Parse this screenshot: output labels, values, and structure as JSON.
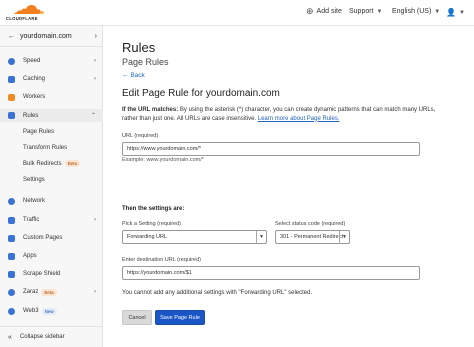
{
  "topbar": {
    "logo_text": "CLOUDFLARE",
    "add_site": "Add site",
    "support": "Support",
    "language": "English (US)"
  },
  "sidebar": {
    "domain": "yourdomain.com",
    "items": [
      {
        "label": "Speed",
        "icon": "speed-icon",
        "color": "#3b73d4",
        "chev": "›"
      },
      {
        "label": "Caching",
        "icon": "caching-icon",
        "color": "#3b73d4",
        "chev": "›"
      },
      {
        "label": "Workers",
        "icon": "workers-icon",
        "color": "#f08a24",
        "chev": ""
      },
      {
        "label": "Rules",
        "icon": "rules-icon",
        "color": "#3b73d4",
        "chev": "⌄"
      },
      {
        "label": "Page Rules"
      },
      {
        "label": "Transform Rules"
      },
      {
        "label": "Bulk Redirects",
        "badge": "Beta"
      },
      {
        "label": "Settings"
      },
      {
        "label": "Network",
        "icon": "network-icon",
        "color": "#3b73d4",
        "chev": ""
      },
      {
        "label": "Traffic",
        "icon": "traffic-icon",
        "color": "#3b73d4",
        "chev": "›"
      },
      {
        "label": "Custom Pages",
        "icon": "custom-pages-icon",
        "color": "#3b73d4",
        "chev": ""
      },
      {
        "label": "Apps",
        "icon": "apps-icon",
        "color": "#3b73d4",
        "chev": ""
      },
      {
        "label": "Scrape Shield",
        "icon": "scrape-shield-icon",
        "color": "#3b73d4",
        "chev": ""
      },
      {
        "label": "Zaraz",
        "icon": "zaraz-icon",
        "color": "#3b73d4",
        "chev": "›",
        "badge": "Beta"
      },
      {
        "label": "Web3",
        "icon": "web3-icon",
        "color": "#3b73d4",
        "chev": "",
        "badge_new": "New"
      }
    ],
    "collapse": "Collapse sidebar"
  },
  "main": {
    "title": "Rules",
    "subtitle": "Page Rules",
    "back": "Back",
    "edit_title": "Edit Page Rule for yourdomain.com",
    "help_bold": "If the URL matches:",
    "help_text": " By using the asterisk (*) character, you can create dynamic patterns that can match many URLs, rather than just one. All URLs are case insensitive. ",
    "help_link": "Learn more about Page Rules.",
    "url_label": "URL (required)",
    "url_value": "https://www.yourdomain.com/*",
    "url_example": "Example: www.yourdomain.com/*",
    "settings_heading": "Then the settings are:",
    "setting_label": "Pick a Setting (required)",
    "setting_value": "Forwarding URL",
    "status_label": "Select status code (required)",
    "status_value": "301 - Permanent Redirect",
    "dest_label": "Enter destination URL (required)",
    "dest_value": "https://yourdomain.com/$1",
    "note": "You cannot add any additional settings with \"Forwarding URL\" selected.",
    "cancel": "Cancel",
    "save": "Save Page Rule"
  }
}
